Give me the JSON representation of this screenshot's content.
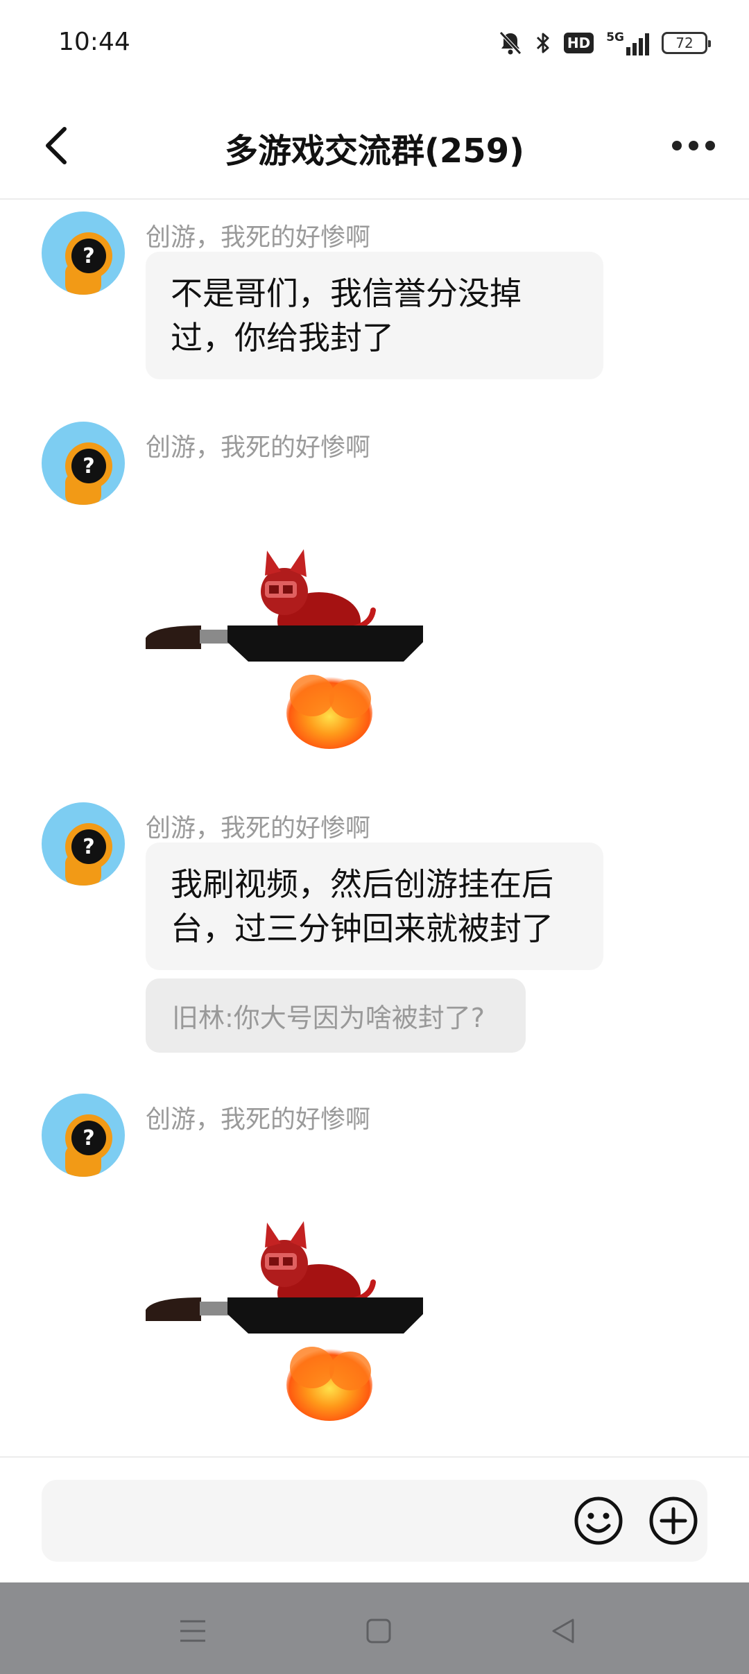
{
  "status_bar": {
    "time": "10:44",
    "network": "5G",
    "hd_badge": "HD",
    "battery": "72",
    "icons": [
      "bell-muted-icon",
      "bluetooth-icon",
      "hd-icon",
      "signal-5g-icon",
      "battery-icon"
    ]
  },
  "header": {
    "title": "多游戏交流群(259)",
    "back_icon": "back-arrow-icon",
    "more_icon": "more-dots-icon"
  },
  "messages": [
    {
      "sender": "创游，我死的好惨啊",
      "type": "text",
      "text_lines": [
        "不是哥们，我信誉分没掉",
        "过，你给我封了"
      ]
    },
    {
      "sender": "创游，我死的好惨啊",
      "type": "sticker",
      "sticker": "cat-in-frying-pan-sticker"
    },
    {
      "sender": "创游，我死的好惨啊",
      "type": "text",
      "text_lines": [
        "我刷视频，然后创游挂在后",
        "台，过三分钟回来就被封了"
      ],
      "quote": "旧林:你大号因为啥被封了?"
    },
    {
      "sender": "创游，我死的好惨啊",
      "type": "sticker",
      "sticker": "cat-in-frying-pan-sticker"
    }
  ],
  "input": {
    "placeholder": "",
    "emoji_icon": "smiley-icon",
    "plus_icon": "plus-circle-icon"
  },
  "nav_bar": {
    "icons": [
      "menu-icon",
      "home-square-icon",
      "back-triangle-icon"
    ]
  },
  "colors": {
    "avatar_bg": "#7dcdf2",
    "avatar_figure": "#f29a16",
    "bubble_bg": "#f5f5f5",
    "quote_bg": "#ececec",
    "nav_bg": "#8c8d90"
  }
}
